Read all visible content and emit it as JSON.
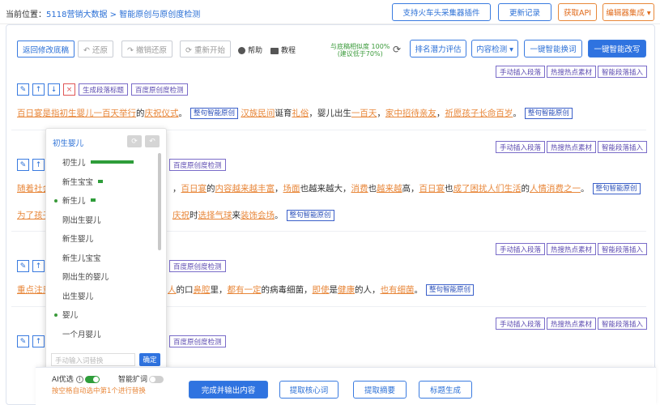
{
  "breadcrumb": {
    "prefix": "当前位置：",
    "item1": "5118营销大数据",
    "sep": " > ",
    "item2": "智能原创与原创度检测"
  },
  "topnav": {
    "plugin": "支持火车头采集器插件",
    "changelog": "更新记录",
    "get_api": "获取API",
    "editor_integration": "编辑器集成 ▾"
  },
  "toolbar": {
    "back": "返回修改底稿",
    "undo": "↶ 还原",
    "redo": "↷ 撤销还原",
    "restart": "⟳ 重新开始",
    "help": "帮助",
    "tutorial": "教程",
    "similarity_line1": "与底稿相似度 100%",
    "similarity_line2": "(建议低于70%)",
    "rank": "排名潜力评估",
    "content_check": "内容检测 ▾",
    "smart_replace": "一键智能换词",
    "smart_rewrite": "一键智能改写"
  },
  "para_tools": {
    "insert": "手动插入段落",
    "hot": "热搜热点素材",
    "smart_insert": "智能段落插入",
    "gen_title": "生成段落标题",
    "originality": "百度原创度检测",
    "rewrite_sentence": "整句智能原创",
    "ok": "确定"
  },
  "p1": {
    "a": "百日宴是指初生婴儿一百天举行",
    "b": "的",
    "c": "庆祝仪式",
    "d": "。",
    "e": "汉族民间",
    "f": "诞育",
    "g": "礼俗",
    "h": "，婴儿出生",
    "i": "一百天",
    "j": "，",
    "k": "家中",
    "l": "招待亲友",
    "m": "，",
    "n": "祈愿孩子长命百岁",
    "o": "。"
  },
  "p2": {
    "a": "随着社会",
    "b": "，",
    "c": "百日宴",
    "d": "的",
    "e": "内容越来越丰富",
    "f": "，",
    "g": "场面",
    "h": "也越来越大，",
    "i": "消费",
    "j": "也",
    "k": "越来越",
    "l": "高，",
    "m": "百日宴",
    "n": "也",
    "o": "成了",
    "p": "困扰",
    "q": "人们生活",
    "r": "的",
    "s": "人情消费之一",
    "t": "。"
  },
  "p2b": {
    "a": "为了孩子",
    "b": "庆祝",
    "c": "时",
    "d": "选择",
    "e": "气球",
    "f": "来",
    "g": "装饰会场",
    "h": "。"
  },
  "p3": {
    "a": "重点注意",
    "b": "人",
    "c": "的口",
    "d": "鼻腔",
    "e": "里，",
    "f": "都有一定",
    "g": "的病毒细菌，",
    "h": "即使",
    "i": "是",
    "j": "健康",
    "k": "的人，",
    "l": "也有",
    "m": "细菌",
    "n": "。"
  },
  "popup": {
    "title": "初生婴儿",
    "items": [
      "初生儿",
      "新生宝宝",
      "新生儿",
      "刚出生婴儿",
      "新生婴儿",
      "新生儿宝宝",
      "刚出生的婴儿",
      "出生婴儿",
      "婴儿",
      "一个月婴儿"
    ],
    "bars": [
      0.85,
      0.08,
      0.08,
      0,
      0,
      0,
      0,
      0,
      0,
      0
    ],
    "dots": [
      false,
      false,
      true,
      false,
      false,
      false,
      false,
      false,
      true,
      false
    ],
    "placeholder": "手动输入词替换",
    "confirm": "确定"
  },
  "bottom": {
    "ai_opt": "AI优选",
    "smart_expand": "智能扩词",
    "hint": "按空格自动选中第1个进行替换",
    "finish": "完成并输出内容",
    "extract_keywords": "提取核心词",
    "extract_summary": "提取摘要",
    "gen_title": "标题生成"
  },
  "colors": {
    "accent": "#2f73e0",
    "orange": "#e8873a",
    "green": "#2e9d3a",
    "purple": "#5b4ab0"
  }
}
